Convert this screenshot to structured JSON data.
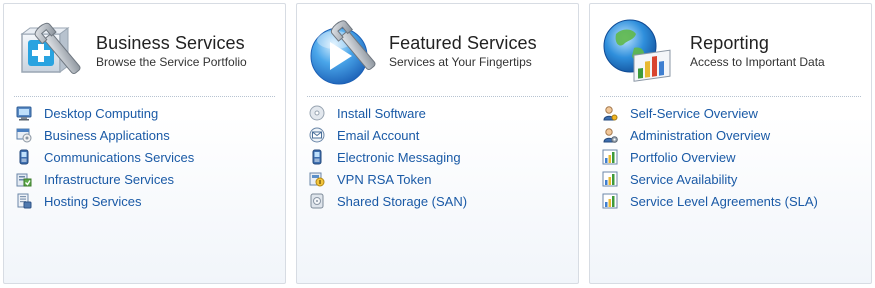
{
  "panels": [
    {
      "title": "Business Services",
      "subtitle": "Browse the Service Portfolio",
      "logo_icon": "business-services-logo",
      "items": [
        {
          "label": "Desktop Computing",
          "icon": "monitor-icon"
        },
        {
          "label": "Business Applications",
          "icon": "application-window-icon"
        },
        {
          "label": "Communications Services",
          "icon": "mobile-phone-icon"
        },
        {
          "label": "Infrastructure Services",
          "icon": "infrastructure-icon"
        },
        {
          "label": "Hosting Services",
          "icon": "server-document-icon"
        }
      ]
    },
    {
      "title": "Featured Services",
      "subtitle": "Services at Your Fingertips",
      "logo_icon": "featured-services-logo",
      "items": [
        {
          "label": "Install Software",
          "icon": "disc-icon"
        },
        {
          "label": "Email Account",
          "icon": "envelope-icon"
        },
        {
          "label": "Electronic Messaging",
          "icon": "mobile-phone-icon"
        },
        {
          "label": "VPN RSA Token",
          "icon": "token-icon"
        },
        {
          "label": "Shared Storage (SAN)",
          "icon": "storage-drive-icon"
        }
      ]
    },
    {
      "title": "Reporting",
      "subtitle": "Access to Important Data",
      "logo_icon": "reporting-logo",
      "items": [
        {
          "label": "Self-Service Overview",
          "icon": "person-icon"
        },
        {
          "label": "Administration Overview",
          "icon": "admin-person-icon"
        },
        {
          "label": "Portfolio Overview",
          "icon": "bar-chart-icon"
        },
        {
          "label": "Service Availability",
          "icon": "bar-chart-icon"
        },
        {
          "label": "Service Level Agreements (SLA)",
          "icon": "bar-chart-icon"
        }
      ]
    }
  ],
  "colors": {
    "link": "#1a5aa6",
    "title": "#222222",
    "border": "#d7dce3"
  }
}
